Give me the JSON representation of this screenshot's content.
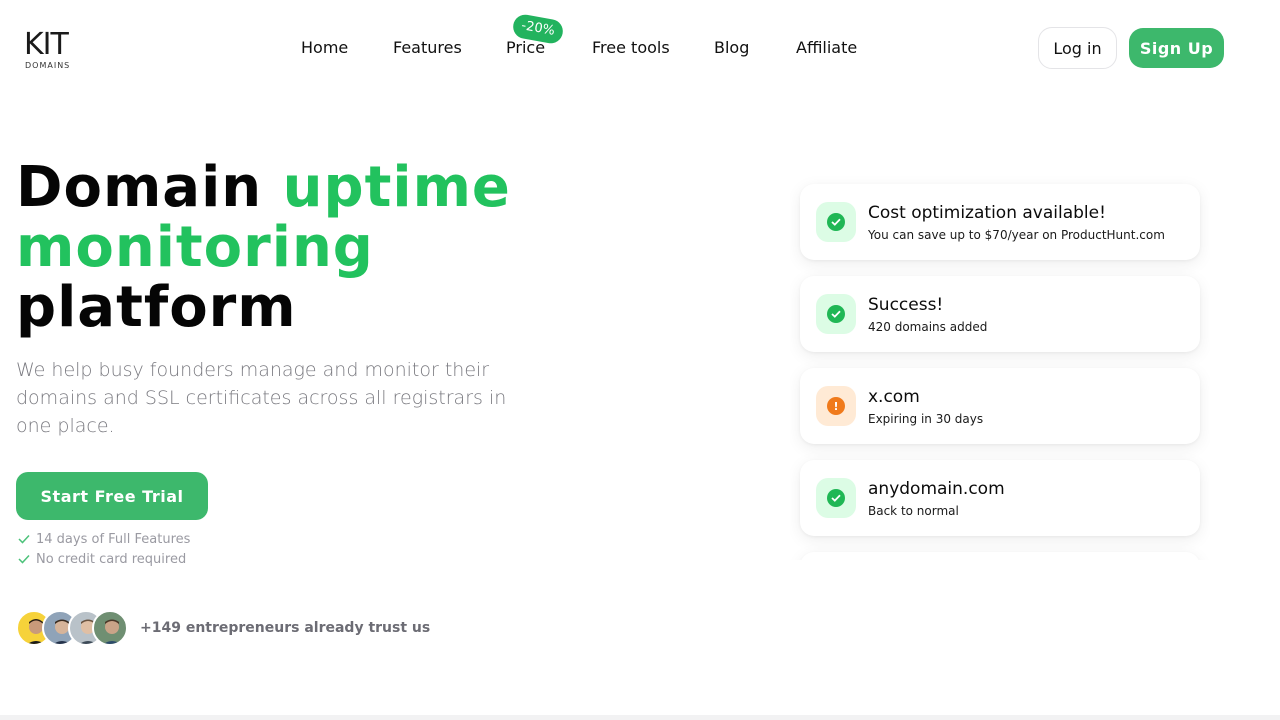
{
  "logo": {
    "main": "KIT",
    "sub": "DOMAINS"
  },
  "nav": {
    "items": [
      {
        "label": "Home"
      },
      {
        "label": "Features"
      },
      {
        "label": "Price"
      },
      {
        "label": "Free tools"
      },
      {
        "label": "Blog"
      },
      {
        "label": "Affiliate"
      }
    ],
    "price_badge": "-20%"
  },
  "auth": {
    "login_label": "Log in",
    "signup_label": "Sign Up"
  },
  "hero": {
    "title_part1": "Domain ",
    "title_part2": "uptime",
    "title_part3": "monitoring",
    "title_part4": "platform",
    "subtitle": "We help busy founders manage and monitor their domains and SSL certificates across all registrars in one place.",
    "cta_label": "Start Free Trial",
    "perks": [
      "14 days of Full Features",
      "No credit card required"
    ],
    "trust_text": "+149 entrepreneurs already trust us"
  },
  "notifications": [
    {
      "title": "Cost optimization available!",
      "text": "You can save up to $70/year on ProductHunt.com",
      "status": "ok",
      "icon": "check-circle-icon"
    },
    {
      "title": "Success!",
      "text": "420 domains added",
      "status": "ok",
      "icon": "check-circle-icon"
    },
    {
      "title": "x.com",
      "text": "Expiring in 30 days",
      "status": "warn",
      "icon": "alert-circle-icon"
    },
    {
      "title": "anydomain.com",
      "text": "Back to normal",
      "status": "ok",
      "icon": "check-circle-icon"
    }
  ],
  "colors": {
    "brand_green": "#3db86c",
    "title_green": "#22c25e",
    "warning_orange": "#f07a1b"
  }
}
